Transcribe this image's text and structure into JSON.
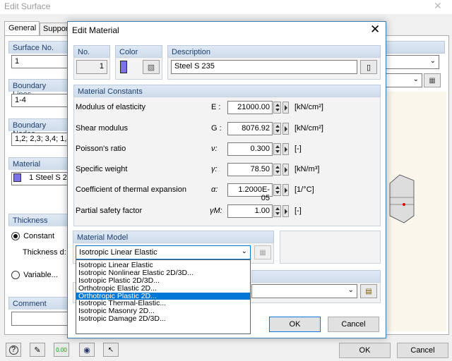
{
  "bg_window": {
    "title": "Edit Surface",
    "tabs": [
      "General",
      "Suppor"
    ],
    "surface_no_label": "Surface No.",
    "surface_no_value": "1",
    "boundary_lines_label": "Boundary Lines",
    "boundary_lines_value": "1-4",
    "boundary_nodes_label": "Boundary Nodes",
    "boundary_nodes_value": "1,2; 2,3; 3,4; 1,4",
    "material_label": "Material",
    "material_no": "1",
    "material_value": "Steel S 23",
    "thickness_label": "Thickness",
    "constant_label": "Constant",
    "thickness_d_label": "Thickness d:",
    "variable_label": "Variable...",
    "comment_label": "Comment",
    "ok_label": "OK",
    "cancel_label": "Cancel"
  },
  "dialog": {
    "title": "Edit Material",
    "no_label": "No.",
    "no_value": "1",
    "color_label": "Color",
    "description_label": "Description",
    "description_value": "Steel S 235",
    "constants_title": "Material Constants",
    "rows": [
      {
        "label": "Modulus of elasticity",
        "symbol": "E :",
        "value": "21000.00",
        "unit": "[kN/cm²]"
      },
      {
        "label": "Shear modulus",
        "symbol": "G :",
        "value": "8076.92",
        "unit": "[kN/cm²]"
      },
      {
        "label": "Poisson's ratio",
        "symbol": "ν:",
        "value": "0.300",
        "unit": "[-]"
      },
      {
        "label": "Specific weight",
        "symbol": "γ:",
        "value": "78.50",
        "unit": "[kN/m³]"
      },
      {
        "label": "Coefficient of thermal expansion",
        "symbol": "α:",
        "value": "1.2000E-05",
        "unit": "[1/°C]"
      },
      {
        "label": "Partial safety factor",
        "symbol": "γM:",
        "value": "1.00",
        "unit": "[-]"
      }
    ],
    "model_title": "Material Model",
    "model_selected": "Isotropic Linear Elastic",
    "model_options": [
      "Isotropic Linear Elastic",
      "Isotropic Nonlinear Elastic 2D/3D...",
      "Isotropic Plastic 2D/3D...",
      "Orthotropic Elastic 2D...",
      "Orthotropic Plastic 2D...",
      "Isotropic Thermal-Elastic...",
      "Isotropic Masonry 2D...",
      "Isotropic Damage 2D/3D..."
    ],
    "highlighted_option_index": 4,
    "ok_label": "OK",
    "cancel_label": "Cancel",
    "color_swatch": "#7b72e6"
  }
}
